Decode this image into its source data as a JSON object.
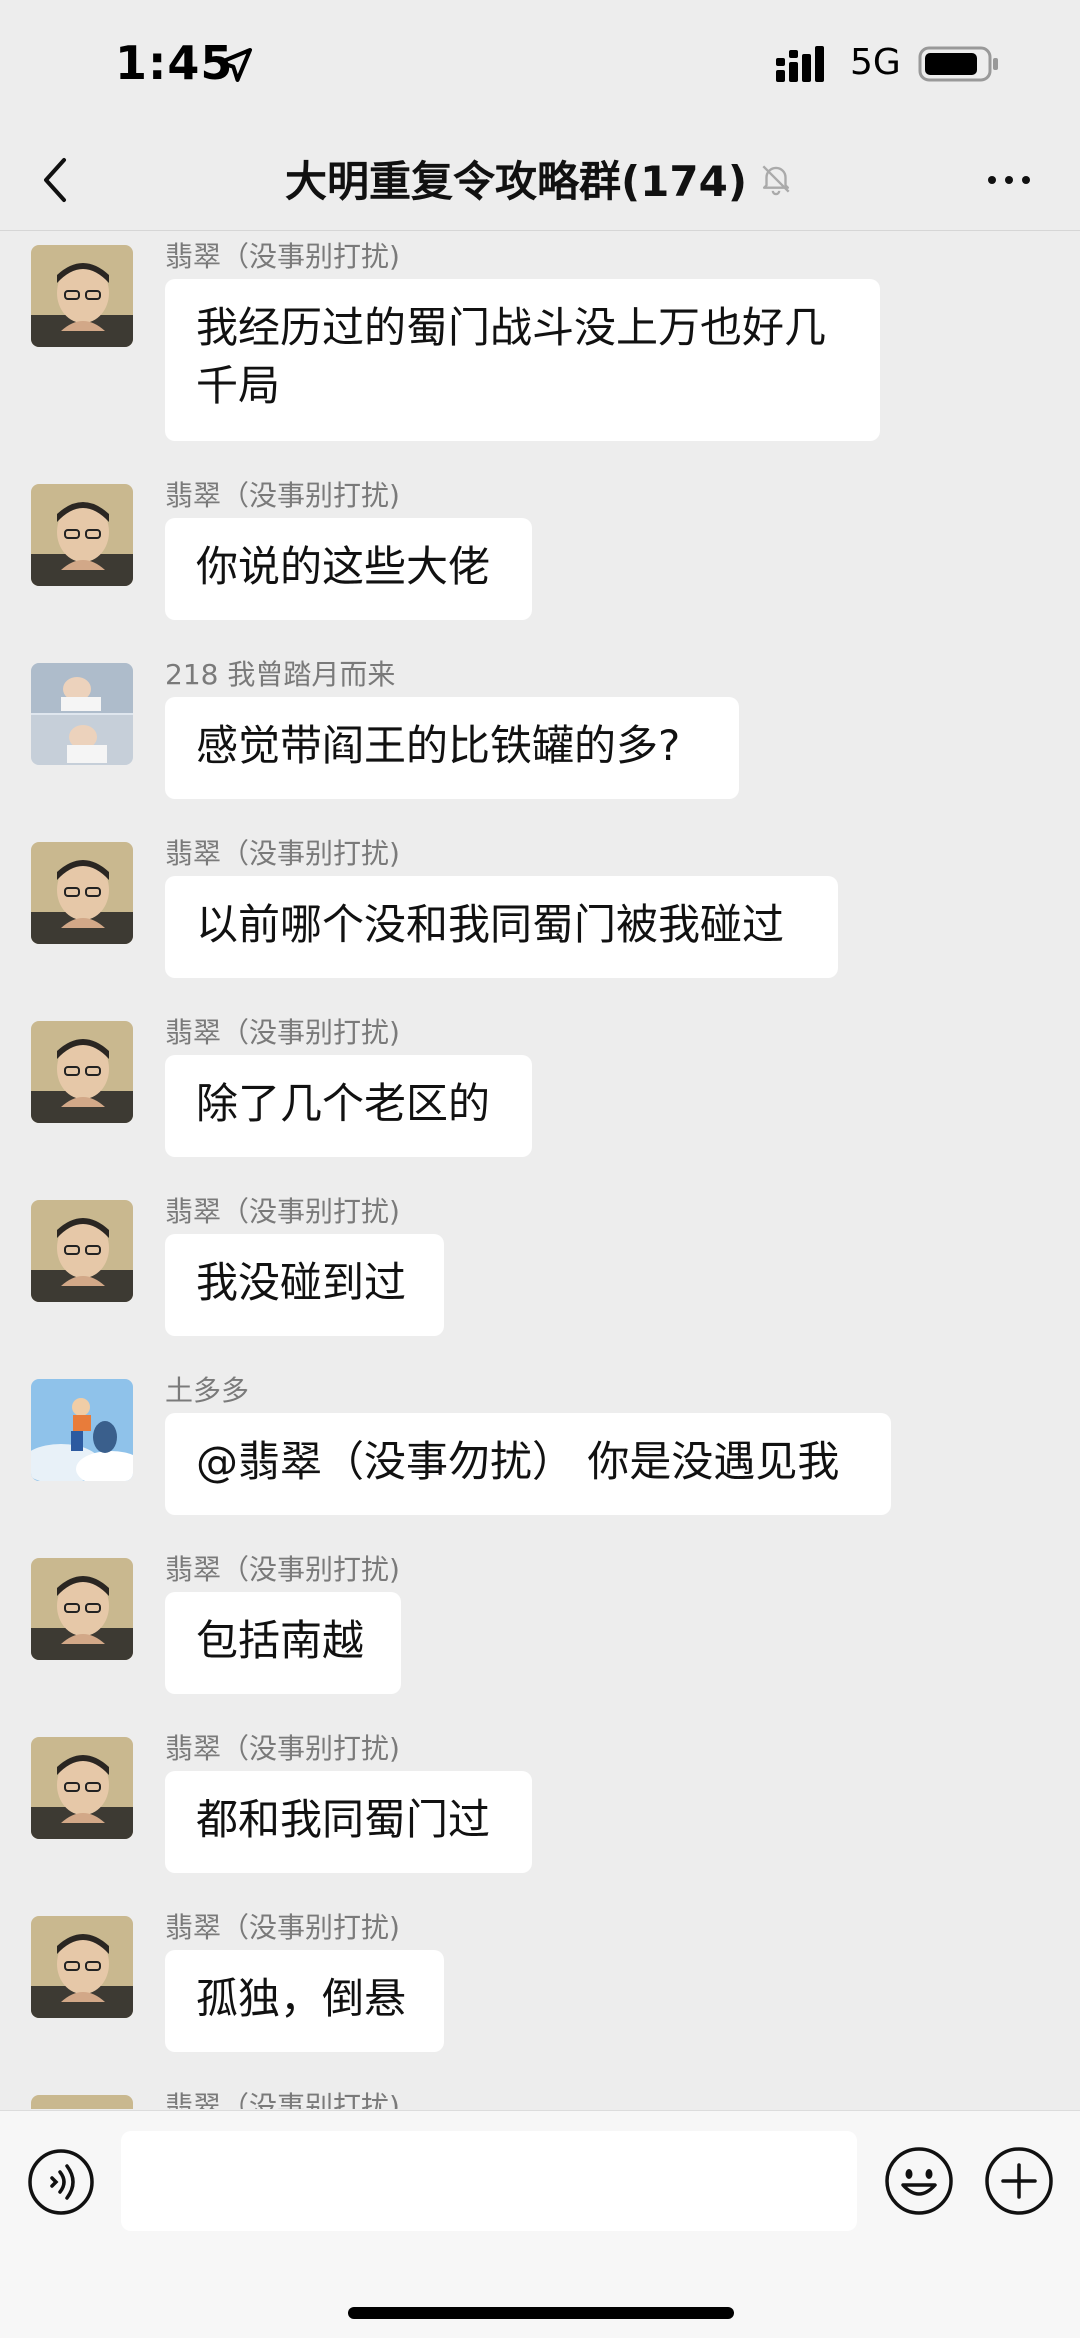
{
  "status_bar": {
    "time": "1:45",
    "network": "5G",
    "location_icon": "location-arrow-icon",
    "signal_icon": "cellular-signal-icon",
    "battery_icon": "battery-icon"
  },
  "header": {
    "title": "大明重复令攻略群(174)",
    "back_icon": "chevron-left-icon",
    "mute_icon": "bell-slash-icon",
    "more_icon": "ellipsis-icon"
  },
  "messages": [
    {
      "sender": "翡翠（没事别打扰)",
      "text_lines": [
        "我经历过的蜀门战斗没上万也好几",
        "千局"
      ],
      "avatar": "avatar-feicui"
    },
    {
      "sender": "翡翠（没事别打扰)",
      "text": "你说的这些大佬",
      "avatar": "avatar-feicui"
    },
    {
      "sender": "218 我曾踏月而来",
      "text": "感觉带阎王的比铁罐的多?",
      "avatar": "avatar-218"
    },
    {
      "sender": "翡翠（没事别打扰)",
      "text": "以前哪个没和我同蜀门被我碰过",
      "avatar": "avatar-feicui"
    },
    {
      "sender": "翡翠（没事别打扰)",
      "text": "除了几个老区的",
      "avatar": "avatar-feicui"
    },
    {
      "sender": "翡翠（没事别打扰)",
      "text": "我没碰到过",
      "avatar": "avatar-feicui"
    },
    {
      "sender": "土多多",
      "text": "@翡翠（没事勿扰） 你是没遇见我",
      "avatar": "avatar-tuduoduo"
    },
    {
      "sender": "翡翠（没事别打扰)",
      "text": "包括南越",
      "avatar": "avatar-feicui"
    },
    {
      "sender": "翡翠（没事别打扰)",
      "text": "都和我同蜀门过",
      "avatar": "avatar-feicui"
    },
    {
      "sender": "翡翠（没事别打扰)",
      "text": "孤独，倒悬",
      "avatar": "avatar-feicui"
    },
    {
      "sender": "翡翠（没事别打扰)",
      "text": "",
      "avatar": "avatar-feicui"
    }
  ],
  "input_bar": {
    "voice_icon": "voice-icon",
    "input_value": "",
    "emoji_icon": "emoji-icon",
    "plus_icon": "plus-icon"
  },
  "colors": {
    "background": "#ededed",
    "bubble": "#ffffff",
    "sender_text": "#7a7a7a"
  }
}
